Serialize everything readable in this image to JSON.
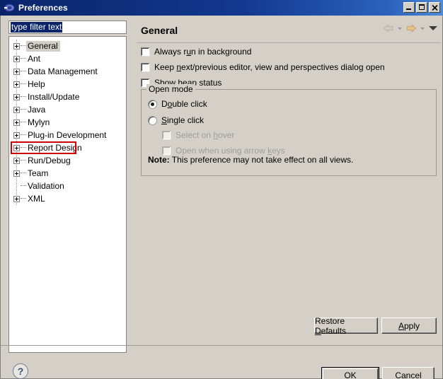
{
  "window": {
    "title": "Preferences",
    "icon": "eclipse-icon",
    "controls": {
      "minimize": "Minimize",
      "maximize": "Maximize",
      "close": "Close"
    }
  },
  "filter": {
    "value": "type filter text",
    "placeholder": "type filter text",
    "selected": true
  },
  "tree": {
    "items": [
      {
        "label": "General",
        "expandable": true,
        "selected": true,
        "highlighted": false
      },
      {
        "label": "Ant",
        "expandable": true,
        "selected": false,
        "highlighted": false
      },
      {
        "label": "Data Management",
        "expandable": true,
        "selected": false,
        "highlighted": false
      },
      {
        "label": "Help",
        "expandable": true,
        "selected": false,
        "highlighted": false
      },
      {
        "label": "Install/Update",
        "expandable": true,
        "selected": false,
        "highlighted": false
      },
      {
        "label": "Java",
        "expandable": true,
        "selected": false,
        "highlighted": false
      },
      {
        "label": "Mylyn",
        "expandable": true,
        "selected": false,
        "highlighted": false
      },
      {
        "label": "Plug-in Development",
        "expandable": true,
        "selected": false,
        "highlighted": false
      },
      {
        "label": "Report Design",
        "expandable": true,
        "selected": false,
        "highlighted": true
      },
      {
        "label": "Run/Debug",
        "expandable": true,
        "selected": false,
        "highlighted": false
      },
      {
        "label": "Team",
        "expandable": true,
        "selected": false,
        "highlighted": false
      },
      {
        "label": "Validation",
        "expandable": false,
        "selected": false,
        "highlighted": false
      },
      {
        "label": "XML",
        "expandable": true,
        "selected": false,
        "highlighted": false
      }
    ],
    "highlight_color": "#cc0000"
  },
  "content": {
    "title": "General",
    "nav": {
      "back": "back-arrow",
      "back_menu": "back-dropdown",
      "forward": "forward-arrow",
      "forward_menu": "forward-dropdown",
      "view_menu": "view-menu"
    },
    "checkboxes": [
      {
        "label_before": "Always r",
        "mnemonic": "u",
        "label_after": "n in background",
        "checked": false,
        "enabled": true
      },
      {
        "label_before": "Keep ",
        "mnemonic": "n",
        "label_after": "ext/previous editor, view and perspectives dialog open",
        "checked": false,
        "enabled": true
      },
      {
        "label_before": "Sho",
        "mnemonic": "w",
        "label_after": " heap status",
        "checked": false,
        "enabled": true
      }
    ],
    "open_mode": {
      "title": "Open mode",
      "radios": [
        {
          "label_before": "D",
          "mnemonic": "o",
          "label_after": "uble click",
          "checked": true
        },
        {
          "label_before": "",
          "mnemonic": "S",
          "label_after": "ingle click",
          "checked": false
        }
      ],
      "sub_checkboxes": [
        {
          "label_before": "Select on ",
          "mnemonic": "h",
          "label_after": "over",
          "checked": false,
          "enabled": false
        },
        {
          "label_before": "Open when using arrow ",
          "mnemonic": "k",
          "label_after": "eys",
          "checked": false,
          "enabled": false
        }
      ],
      "note_label": "Note:",
      "note_text": " This preference may not take effect on all views."
    }
  },
  "buttons": {
    "restore_defaults_before": "Restore ",
    "restore_defaults_mnemonic": "D",
    "restore_defaults_after": "efaults",
    "apply_before": "",
    "apply_mnemonic": "A",
    "apply_after": "pply",
    "ok": "OK",
    "cancel": "Cancel",
    "help": "?"
  }
}
